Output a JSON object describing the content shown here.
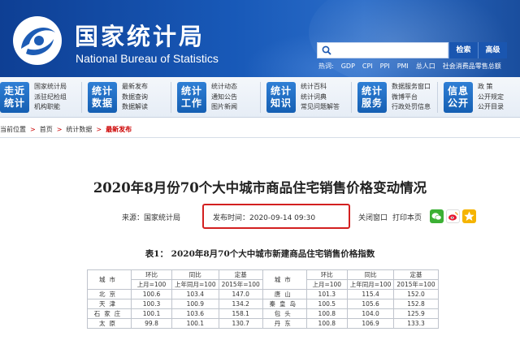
{
  "header": {
    "title_cn": "国家统计局",
    "title_en": "National Bureau of Statistics",
    "search_btn": "检索",
    "advanced_btn": "高级",
    "hot_label": "热词:",
    "hot_words": [
      "GDP",
      "CPI",
      "PPI",
      "PMI",
      "总人口",
      "社会消费品零售总额"
    ]
  },
  "nav": [
    {
      "tile": [
        "走近",
        "统计"
      ],
      "links": [
        "国家统计局",
        "派驻纪检组",
        "机构职能"
      ]
    },
    {
      "tile": [
        "统计",
        "数据"
      ],
      "links": [
        "最新发布",
        "数据查询",
        "数据解读"
      ]
    },
    {
      "tile": [
        "统计",
        "工作"
      ],
      "links": [
        "统计动态",
        "通知公告",
        "图片新闻"
      ]
    },
    {
      "tile": [
        "统计",
        "知识"
      ],
      "links": [
        "统计百科",
        "统计词典",
        "常见问题解答"
      ]
    },
    {
      "tile": [
        "统计",
        "服务"
      ],
      "links": [
        "数据服务窗口",
        "微博平台",
        "行政处罚信息"
      ]
    },
    {
      "tile": [
        "信息",
        "公开"
      ],
      "links": [
        "政  策",
        "公开规定",
        "公开目录"
      ]
    }
  ],
  "breadcrumb": {
    "position": "当前位置",
    "home": "首页",
    "stats": "统计数据",
    "current": "最新发布"
  },
  "article": {
    "title": "2020年8月份70个大中城市商品住宅销售价格变动情况",
    "source": "来源：国家统计局",
    "publish_time": "发布时间：2020-09-14   09:30",
    "close": "关闭窗口",
    "print": "打印本页"
  },
  "table": {
    "title": "表1：  2020年8月70个大中城市新建商品住宅销售价格指数",
    "col_city": "城市",
    "col_mom": "环比",
    "col_yoy": "同比",
    "col_base": "定基",
    "sub_mom": "上月=100",
    "sub_yoy": "上年同月=100",
    "sub_base": "2015年=100",
    "rows": [
      {
        "c1": "北京",
        "a1": "100.6",
        "b1": "103.4",
        "d1": "147.0",
        "c2": "唐山",
        "a2": "101.3",
        "b2": "115.4",
        "d2": "152.0"
      },
      {
        "c1": "天津",
        "a1": "100.3",
        "b1": "100.9",
        "d1": "134.2",
        "c2": "秦皇岛",
        "a2": "100.5",
        "b2": "105.6",
        "d2": "152.8"
      },
      {
        "c1": "石家庄",
        "a1": "100.1",
        "b1": "103.6",
        "d1": "158.1",
        "c2": "包头",
        "a2": "100.8",
        "b2": "104.0",
        "d2": "125.9"
      },
      {
        "c1": "太原",
        "a1": "99.8",
        "b1": "100.1",
        "d1": "130.7",
        "c2": "丹东",
        "a2": "100.8",
        "b2": "106.9",
        "d2": "133.3"
      }
    ]
  }
}
